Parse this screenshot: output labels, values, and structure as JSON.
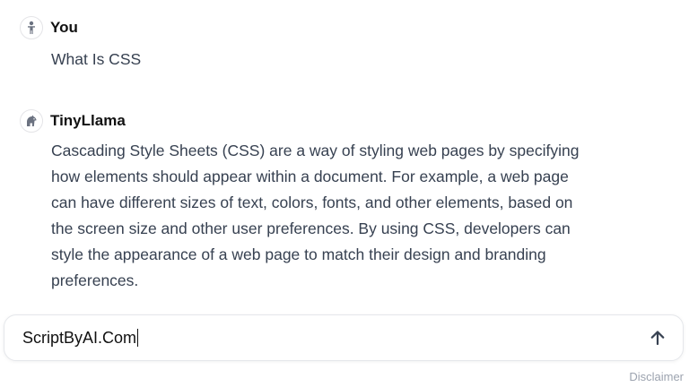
{
  "messages": [
    {
      "author": "You",
      "avatar_icon": "person-icon",
      "text": "What Is CSS"
    },
    {
      "author": "TinyLlama",
      "avatar_icon": "llama-icon",
      "lines": [
        "Cascading Style Sheets (CSS) are a way of styling web pages by specifying",
        "how elements should appear within a document. For example, a web page",
        "can have different sizes of text, colors, fonts, and other elements, based on",
        "the screen size and other user preferences. By using CSS, developers can",
        "style the appearance of a web page to match their design and branding",
        "preferences."
      ]
    }
  ],
  "composer": {
    "value": "ScriptByAI.Com",
    "send_icon": "arrow-up-icon"
  },
  "footer": {
    "disclaimer": "Disclaimer"
  },
  "colors": {
    "text_primary": "#111111",
    "text_body": "#374151",
    "muted": "#9ca3af",
    "icon": "#6b7280"
  }
}
